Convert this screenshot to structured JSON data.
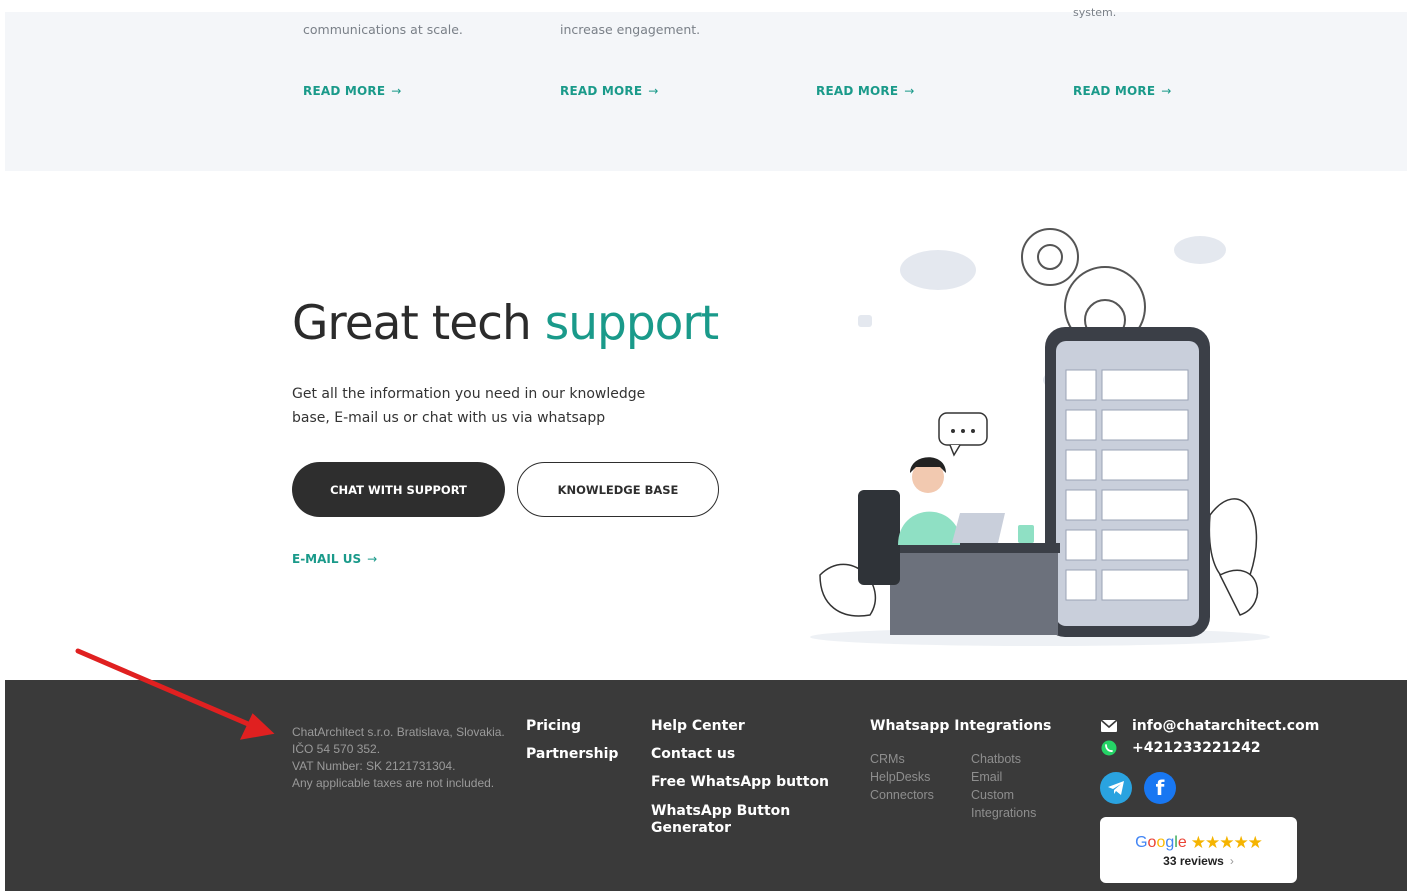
{
  "top_cards": {
    "tails": [
      "communications at scale.",
      "increase engagement.",
      "",
      "system."
    ],
    "read_more_label": "READ MORE",
    "arrow": "→"
  },
  "support": {
    "title_main": "Great tech ",
    "title_accent": "support",
    "description": "Get all the information you need in our knowledge base, E-mail us or chat with us via whatsapp",
    "chat_button": "CHAT WITH SUPPORT",
    "kb_button": "KNOWLEDGE BASE",
    "email_link": "E-MAIL US",
    "arrow": "→"
  },
  "footer": {
    "company_lines": [
      "ChatArchitect s.r.o. Bratislava, Slovakia.",
      "IČO 54 570 352.",
      "VAT Number: SK 2121731304.",
      "Any applicable taxes are not included."
    ],
    "col1": [
      "Pricing",
      "Partnership"
    ],
    "col2": [
      "Help Center",
      "Contact us",
      "Free WhatsApp button",
      "WhatsApp Button Generator"
    ],
    "integrations_title": "Whatsapp Integrations",
    "integrations_left": [
      "CRMs",
      "HelpDesks",
      "Connectors"
    ],
    "integrations_right": [
      "Chatbots",
      "Email",
      "Custom Integrations"
    ],
    "email": "info@chatarchitect.com",
    "phone": "+421233221242",
    "google": {
      "brand": "Google",
      "stars": "★★★★★",
      "reviews": "33 reviews",
      "chevron": "›"
    }
  },
  "colors": {
    "accent": "#1a9a8a",
    "footer_bg": "#3a3a3a",
    "dark_button": "#2e2e2e",
    "annotation_arrow": "#e02020"
  },
  "icons": [
    "arrow-right-icon",
    "mail-icon",
    "whatsapp-icon",
    "telegram-icon",
    "facebook-icon",
    "star-icon",
    "chevron-right-icon"
  ]
}
